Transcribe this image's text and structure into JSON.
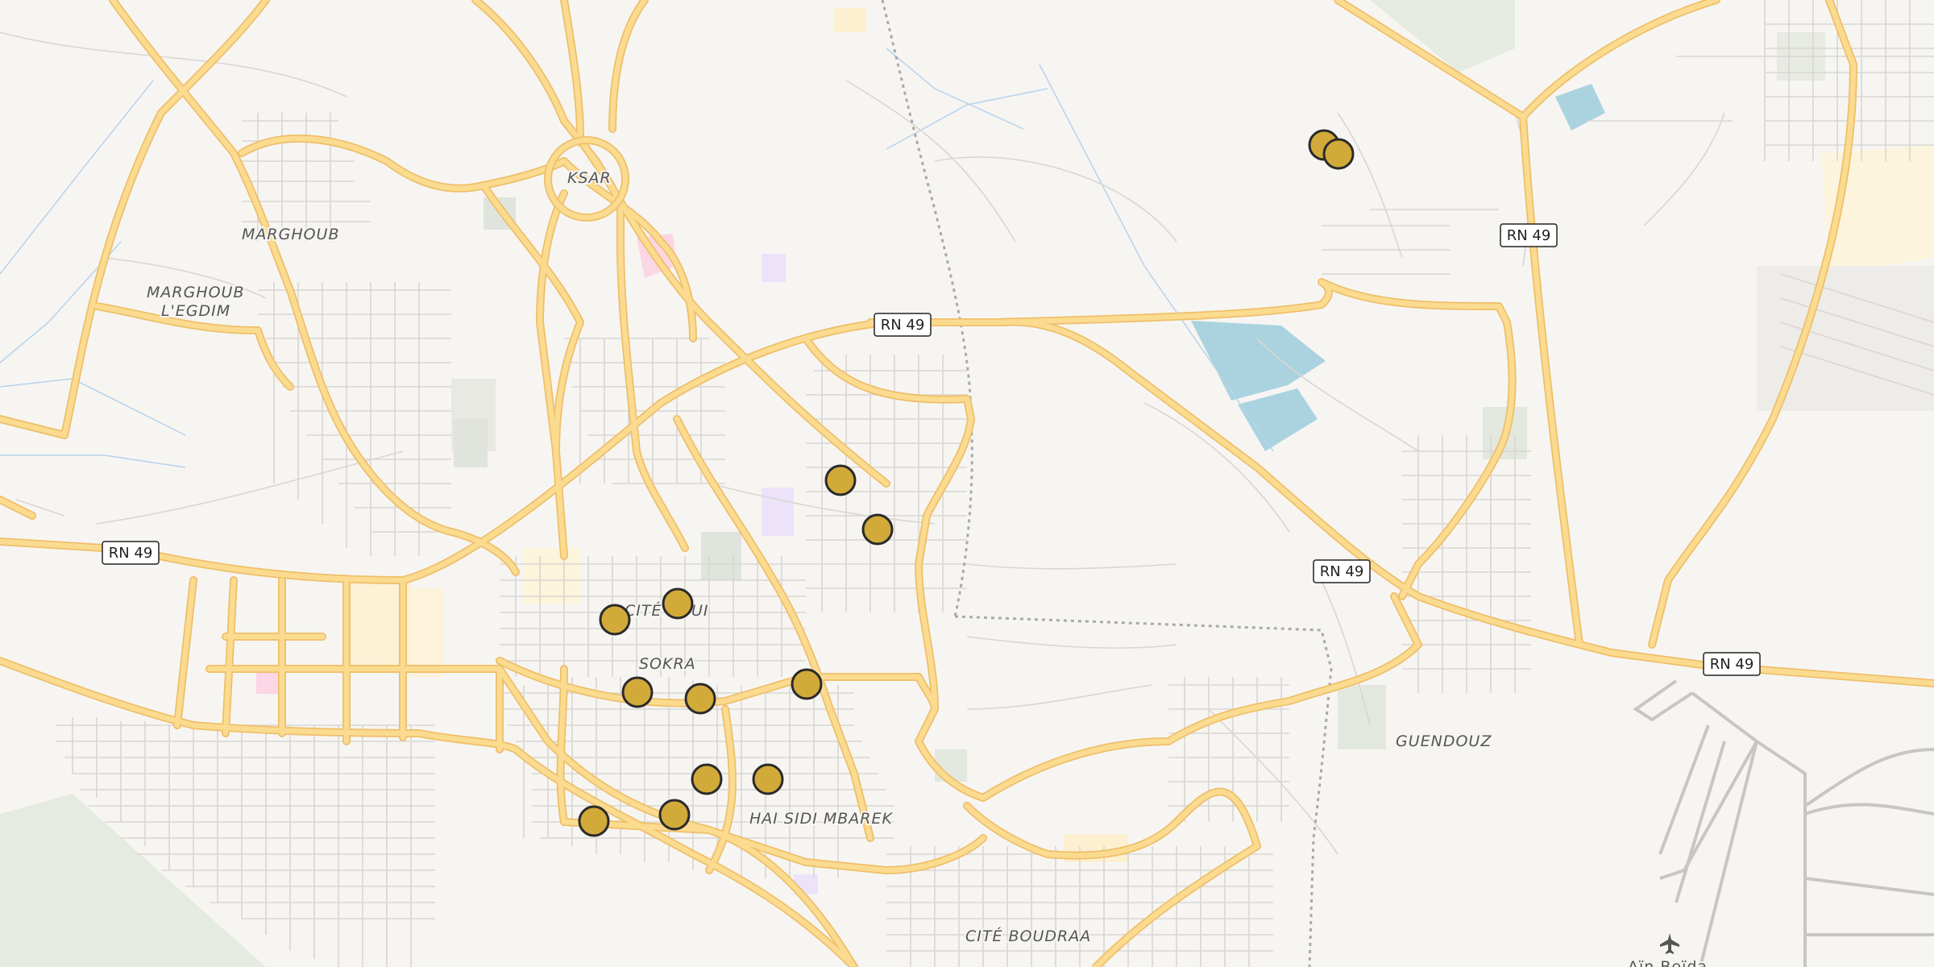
{
  "map": {
    "places": [
      {
        "id": "ksar",
        "name": "KSAR"
      },
      {
        "id": "marghoub",
        "name": "MARGHOUB"
      },
      {
        "id": "marghoub-legdim-1",
        "name": "MARGHOUB"
      },
      {
        "id": "marghoub-legdim-2",
        "name": "L'EGDIM"
      },
      {
        "id": "cite-partial",
        "name": "CITÉ"
      },
      {
        "id": "ui-partial",
        "name": "UI"
      },
      {
        "id": "sokra",
        "name": "SOKRA"
      },
      {
        "id": "hai-sidi-mbarek",
        "name": "HAI SIDI MBAREK"
      },
      {
        "id": "cite-boudraa",
        "name": "CITÉ BOUDRAA"
      },
      {
        "id": "guendouz",
        "name": "GUENDOUZ"
      },
      {
        "id": "ain-beida",
        "name": "Aïn Beïda"
      }
    ],
    "road_shields": [
      {
        "id": "rn49-a",
        "label": "RN 49"
      },
      {
        "id": "rn49-b",
        "label": "RN 49"
      },
      {
        "id": "rn49-c",
        "label": "RN 49"
      },
      {
        "id": "rn49-d",
        "label": "RN 49"
      },
      {
        "id": "rn49-e",
        "label": "RN 49"
      }
    ],
    "markers": [
      {
        "id": "m1",
        "color": "#d1aa3a"
      },
      {
        "id": "m2",
        "color": "#d1aa3a"
      },
      {
        "id": "m3",
        "color": "#d1aa3a"
      },
      {
        "id": "m4",
        "color": "#d1aa3a"
      },
      {
        "id": "m5",
        "color": "#d1aa3a"
      },
      {
        "id": "m6",
        "color": "#d1aa3a"
      },
      {
        "id": "m7",
        "color": "#d1aa3a"
      },
      {
        "id": "m8",
        "color": "#d1aa3a"
      },
      {
        "id": "m9",
        "color": "#d1aa3a"
      },
      {
        "id": "m10",
        "color": "#d1aa3a"
      },
      {
        "id": "m11",
        "color": "#d1aa3a"
      },
      {
        "id": "m12",
        "color": "#d1aa3a"
      },
      {
        "id": "m13",
        "color": "#d1aa3a"
      },
      {
        "id": "m14",
        "color": "#d1aa3a"
      }
    ],
    "colors": {
      "background": "#f7f5f2",
      "major_road": "#fbdb8f",
      "major_road_casing": "#eebf6a",
      "minor_road": "#d8d6d3",
      "water": "#aad3df",
      "park": "#dfe6dc",
      "marker_fill": "#d1aa3a",
      "marker_stroke": "#2a2a2a"
    },
    "airport_icon": "airplane-icon"
  }
}
